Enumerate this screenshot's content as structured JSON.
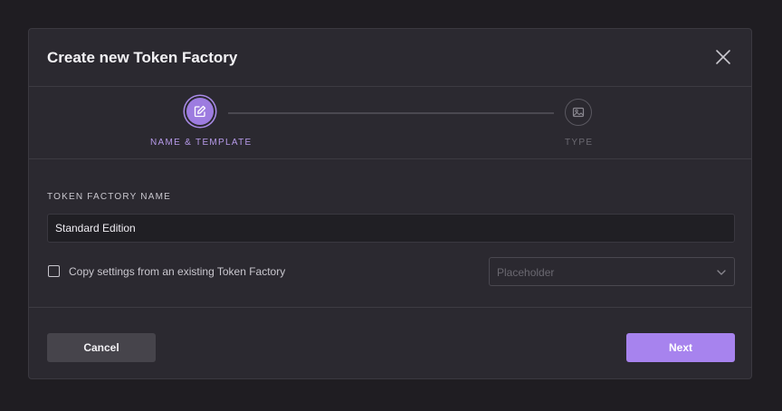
{
  "dialog": {
    "title": "Create new Token Factory"
  },
  "stepper": {
    "steps": [
      {
        "label": "NAME & TEMPLATE",
        "icon": "edit-icon",
        "state": "active"
      },
      {
        "label": "TYPE",
        "icon": "image-icon",
        "state": "inactive"
      }
    ]
  },
  "form": {
    "name_label": "TOKEN FACTORY NAME",
    "name_value": "Standard Edition",
    "copy_checkbox_label": "Copy settings from an existing Token Factory",
    "copy_checkbox_checked": false,
    "template_select_placeholder": "Placeholder"
  },
  "footer": {
    "cancel_label": "Cancel",
    "next_label": "Next"
  },
  "colors": {
    "accent": "#a783ee",
    "modal_bg": "#2b2930",
    "page_bg": "#1f1d22"
  }
}
